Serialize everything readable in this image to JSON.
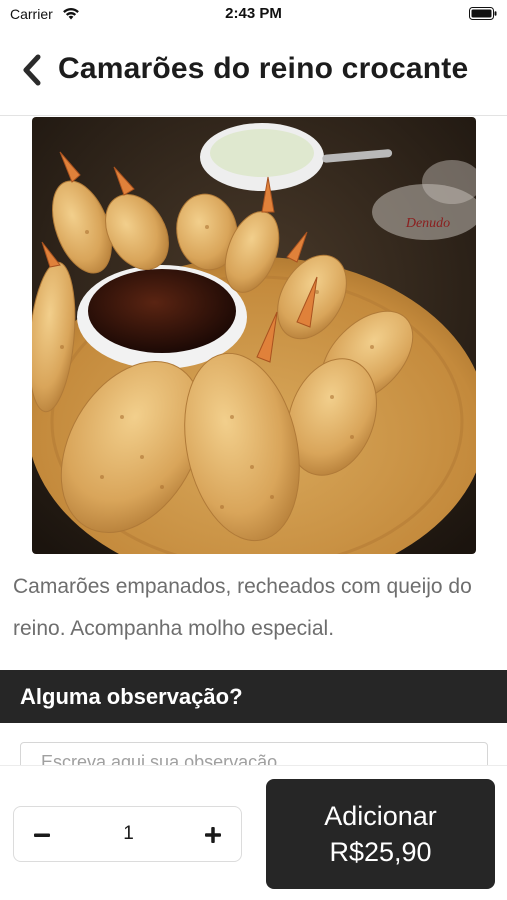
{
  "status_bar": {
    "carrier": "Carrier",
    "time": "2:43 PM"
  },
  "nav": {
    "title": "Camarões do reino crocante",
    "back_icon": "chevron-left-icon"
  },
  "product": {
    "image_icon": "fried-shrimp-photo",
    "image_watermark": "Denudo",
    "description": "Camarões empanados, recheados com queijo do reino. Acompanha molho especial."
  },
  "observation": {
    "header": "Alguma observação?",
    "placeholder": "Escreva aqui sua observação..."
  },
  "order": {
    "quantity": "1",
    "minus_icon": "minus-icon",
    "plus_icon": "plus-icon",
    "add_label": "Adicionar",
    "price": "R$25,90"
  },
  "colors": {
    "dark": "#262626",
    "text_muted": "#6e6e6e",
    "background": "#ffffff"
  }
}
